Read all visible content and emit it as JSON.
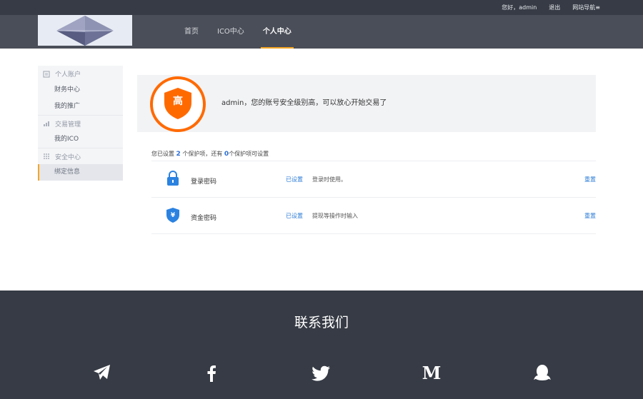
{
  "topbar": {
    "greeting": "您好，admin",
    "logout": "退出",
    "site_nav": "网站导航≡"
  },
  "nav": {
    "items": [
      {
        "label": "首页"
      },
      {
        "label": "ICO中心"
      },
      {
        "label": "个人中心",
        "active": true
      }
    ]
  },
  "sidebar": {
    "groups": [
      {
        "title": "个人账户",
        "items": [
          "财务中心",
          "我的推广"
        ]
      },
      {
        "title": "交易管理",
        "items": [
          "我的ICO"
        ]
      },
      {
        "title": "安全中心",
        "items": [
          "绑定信息"
        ]
      }
    ],
    "active_item": "绑定信息"
  },
  "security": {
    "level_badge": "高",
    "message": "admin，您的账号安全级别高，可以放心开始交易了",
    "summary_prefix": "您已设置",
    "summary_set": "2",
    "summary_mid": "个保护项，还有",
    "summary_unset": "0",
    "summary_suffix": "个保护项可设置",
    "rows": [
      {
        "name": "登录密码",
        "status": "已设置",
        "desc": "登录时使用。",
        "action": "重置",
        "icon": "lock-icon"
      },
      {
        "name": "资金密码",
        "status": "已设置",
        "desc": "提现等操作时输入",
        "action": "重置",
        "icon": "yuan-shield-icon"
      }
    ]
  },
  "footer": {
    "title": "联系我们",
    "social": [
      "telegram-icon",
      "facebook-icon",
      "twitter-icon",
      "medium-icon",
      "qq-icon"
    ]
  },
  "colors": {
    "accent": "#f5a623",
    "shield_orange": "#ff6a00",
    "link_blue": "#2b7bd6",
    "dark_bg": "#363b45"
  }
}
